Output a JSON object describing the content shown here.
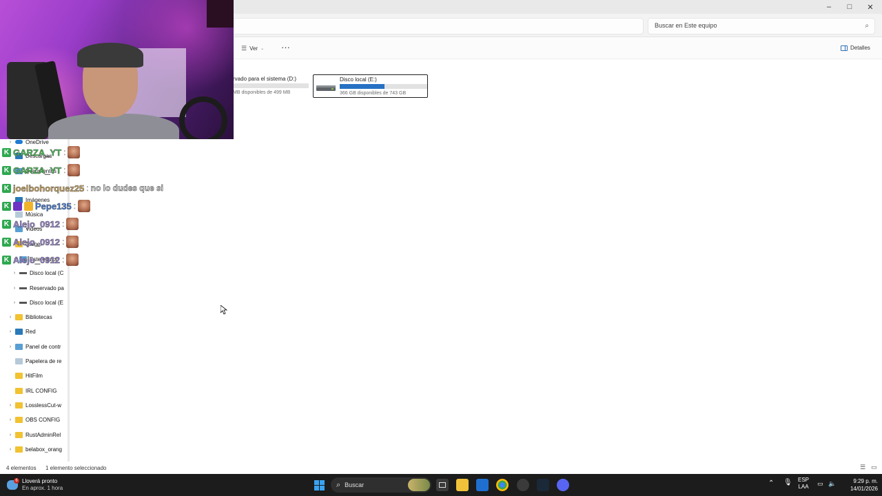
{
  "window": {
    "search_placeholder": "Buscar en Este equipo",
    "controls": {
      "minimize": "–",
      "maximize": "□",
      "close": "✕"
    }
  },
  "command_bar": {
    "view_label": "Ver",
    "more_label": "···",
    "details_label": "Detalles"
  },
  "drives": [
    {
      "name": "rvado para el sistema (D:)",
      "free": "MB disponibles de 499 MB",
      "used_fraction": 0.0
    },
    {
      "name": "Disco local (E:)",
      "free": "366 GB disponibles de 743 GB",
      "used_fraction": 0.51
    }
  ],
  "nav": {
    "items": [
      {
        "label": "OneDrive",
        "icon": "onedrive-icon",
        "chevron": true
      },
      {
        "label": "Descargas",
        "icon": "download-icon",
        "chevron": false
      },
      {
        "label": "Documentos",
        "icon": "documents-icon",
        "chevron": false
      },
      {
        "label": "Imágenes",
        "icon": "pictures-icon",
        "chevron": false
      },
      {
        "label": "Música",
        "icon": "music-icon",
        "chevron": false
      },
      {
        "label": "Videos",
        "icon": "videos-icon",
        "chevron": false
      },
      {
        "label": "Jasnel",
        "icon": "folder-icon",
        "chevron": false
      },
      {
        "label": "Este equipo",
        "icon": "pc-icon",
        "chevron": true
      },
      {
        "label": "Disco local (C",
        "icon": "drive-icon",
        "chevron": true
      },
      {
        "label": "Reservado pa",
        "icon": "drive-icon",
        "chevron": true
      },
      {
        "label": "Disco local (E",
        "icon": "drive-icon",
        "chevron": true
      },
      {
        "label": "Bibliotecas",
        "icon": "folder-icon",
        "chevron": true
      },
      {
        "label": "Red",
        "icon": "network-icon",
        "chevron": true
      },
      {
        "label": "Panel de contr",
        "icon": "control-panel-icon",
        "chevron": true
      },
      {
        "label": "Papelera de re",
        "icon": "recycle-bin-icon",
        "chevron": false
      },
      {
        "label": "HitFilm",
        "icon": "folder-icon",
        "chevron": false
      },
      {
        "label": "IRL CONFIG",
        "icon": "folder-icon",
        "chevron": false
      },
      {
        "label": "LosslessCut-w",
        "icon": "folder-icon",
        "chevron": true
      },
      {
        "label": "OBS CONFIG",
        "icon": "folder-icon",
        "chevron": true
      },
      {
        "label": "RustAdminRel",
        "icon": "folder-icon",
        "chevron": true
      },
      {
        "label": "belabox_orang",
        "icon": "folder-icon",
        "chevron": true
      }
    ]
  },
  "chat": [
    {
      "user": "GARZA_YT",
      "color": "#3fd14f",
      "badges": [
        "k"
      ],
      "message": "",
      "emote": true
    },
    {
      "user": "GARZA_YT",
      "color": "#3fd14f",
      "badges": [
        "k"
      ],
      "message": "",
      "emote": true
    },
    {
      "user": "joelbohorquez25",
      "color": "#e0b25a",
      "badges": [
        "k"
      ],
      "message": "no lo dudes que si",
      "emote": false
    },
    {
      "user": "Pepe135",
      "color": "#3b82f6",
      "badges": [
        "k",
        "sub",
        "crown"
      ],
      "message": "",
      "emote": true
    },
    {
      "user": "Alejo_0912",
      "color": "#a58ae6",
      "badges": [
        "k"
      ],
      "message": "",
      "emote": true
    },
    {
      "user": "Alejo_0912",
      "color": "#a58ae6",
      "badges": [
        "k"
      ],
      "message": "",
      "emote": true
    },
    {
      "user": "Alejo_0912",
      "color": "#a58ae6",
      "badges": [
        "k"
      ],
      "message": "",
      "emote": true
    }
  ],
  "status": {
    "items_count": "4 elementos",
    "selected": "1 elemento seleccionado"
  },
  "taskbar": {
    "weather_title": "Lloverá pronto",
    "weather_sub": "En aprox. 1 hora",
    "weather_badge": "6",
    "search_label": "Buscar",
    "lang_top": "ESP",
    "lang_bottom": "LAA",
    "time": "9:29 p. m.",
    "date": "14/01/2026"
  }
}
